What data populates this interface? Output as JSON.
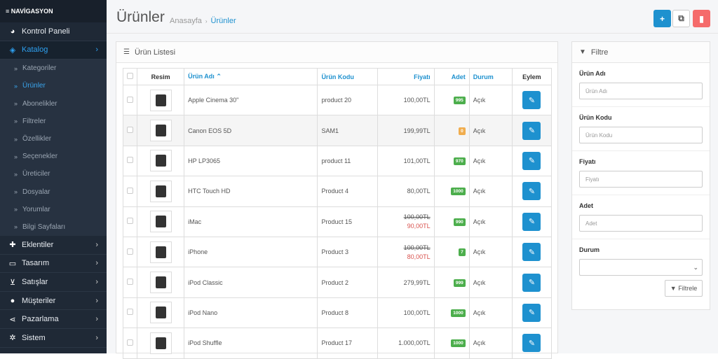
{
  "sidebar": {
    "header": "≡ NAVİGASYON",
    "top_items": [
      {
        "label": "Kontrol Paneli",
        "icon": "dashboard-icon"
      }
    ],
    "catalog": {
      "label": "Katalog",
      "icon": "tag-icon"
    },
    "sub_items": [
      {
        "label": "Kategoriler"
      },
      {
        "label": "Ürünler"
      },
      {
        "label": "Abonelikler"
      },
      {
        "label": "Filtreler"
      },
      {
        "label": "Özellikler"
      },
      {
        "label": "Seçenekler"
      },
      {
        "label": "Üreticiler"
      },
      {
        "label": "Dosyalar"
      },
      {
        "label": "Yorumlar"
      },
      {
        "label": "Bilgi Sayfaları"
      }
    ],
    "bottom_items": [
      {
        "label": "Eklentiler",
        "icon": "puzzle-icon"
      },
      {
        "label": "Tasarım",
        "icon": "monitor-icon"
      },
      {
        "label": "Satışlar",
        "icon": "cart-icon"
      },
      {
        "label": "Müşteriler",
        "icon": "user-icon"
      },
      {
        "label": "Pazarlama",
        "icon": "share-icon"
      },
      {
        "label": "Sistem",
        "icon": "gear-icon"
      }
    ]
  },
  "header": {
    "title": "Ürünler",
    "breadcrumb_home": "Anasayfa",
    "breadcrumb_current": "Ürünler"
  },
  "list": {
    "title": "Ürün Listesi",
    "columns": {
      "image": "Resim",
      "name": "Ürün Adı",
      "model": "Ürün Kodu",
      "price": "Fiyatı",
      "quantity": "Adet",
      "status": "Durum",
      "action": "Eylem"
    },
    "rows": [
      {
        "name": "Apple Cinema 30\"",
        "model": "product 20",
        "price": "100,00TL",
        "special": "",
        "quantity": "995",
        "status": "Açık"
      },
      {
        "name": "Canon EOS 5D",
        "model": "SAM1",
        "price": "199,99TL",
        "special": "",
        "quantity": "0",
        "status": "Açık"
      },
      {
        "name": "HP LP3065",
        "model": "product 11",
        "price": "101,00TL",
        "special": "",
        "quantity": "970",
        "status": "Açık"
      },
      {
        "name": "HTC Touch HD",
        "model": "Product 4",
        "price": "80,00TL",
        "special": "",
        "quantity": "1000",
        "status": "Açık"
      },
      {
        "name": "iMac",
        "model": "Product 15",
        "price": "100,00TL",
        "special": "90,00TL",
        "quantity": "990",
        "status": "Açık"
      },
      {
        "name": "iPhone",
        "model": "Product 3",
        "price": "100,00TL",
        "special": "80,00TL",
        "quantity": "7",
        "status": "Açık"
      },
      {
        "name": "iPod Classic",
        "model": "Product 2",
        "price": "279,99TL",
        "special": "",
        "quantity": "999",
        "status": "Açık"
      },
      {
        "name": "iPod Nano",
        "model": "Product 8",
        "price": "100,00TL",
        "special": "",
        "quantity": "1000",
        "status": "Açık"
      },
      {
        "name": "iPod Shuffle",
        "model": "Product 17",
        "price": "1.000,00TL",
        "special": "",
        "quantity": "1000",
        "status": "Açık"
      }
    ]
  },
  "filter": {
    "title": "Filtre",
    "name_label": "Ürün Adı",
    "name_placeholder": "Ürün Adı",
    "model_label": "Ürün Kodu",
    "model_placeholder": "Ürün Kodu",
    "price_label": "Fiyatı",
    "price_placeholder": "Fiyatı",
    "quantity_label": "Adet",
    "quantity_placeholder": "Adet",
    "status_label": "Durum",
    "status_value": "",
    "button": "Filtrele"
  },
  "colors": {
    "primary": "#1e91cf",
    "danger": "#f56b6b",
    "success": "#4cae4c",
    "warning": "#f0ad4e",
    "sidebar": "#1f2936"
  }
}
